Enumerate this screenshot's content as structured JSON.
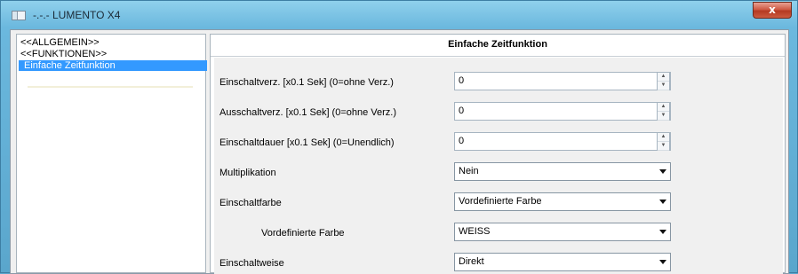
{
  "window": {
    "title": "-.-.- LUMENTO X4",
    "close_glyph": "x",
    "app_icon": "window-app-icon"
  },
  "tree": {
    "items": [
      {
        "label": "<<ALLGEMEIN>>",
        "selected": false
      },
      {
        "label": "<<FUNKTIONEN>>",
        "selected": false
      },
      {
        "label": "Einfache Zeitfunktion",
        "selected": true
      }
    ]
  },
  "panel": {
    "title": "Einfache Zeitfunktion",
    "rows": [
      {
        "label": "Einschaltverz. [x0.1 Sek] (0=ohne Verz.)",
        "value": "0",
        "type": "spin"
      },
      {
        "label": "Ausschaltverz. [x0.1 Sek] (0=ohne Verz.)",
        "value": "0",
        "type": "spin"
      },
      {
        "label": "Einschaltdauer [x0.1 Sek] (0=Unendlich)",
        "value": "0",
        "type": "spin"
      },
      {
        "label": "Multiplikation",
        "value": "Nein",
        "type": "select"
      },
      {
        "label": "Einschaltfarbe",
        "value": "Vordefinierte Farbe",
        "type": "select"
      },
      {
        "label": "Vordefinierte Farbe",
        "value": "WEISS",
        "type": "select"
      },
      {
        "label": "Einschaltweise",
        "value": "Direkt",
        "type": "select"
      }
    ]
  },
  "colors": {
    "selection": "#3399ff",
    "chrome": "#6bb8de",
    "close": "#cf5b45"
  }
}
